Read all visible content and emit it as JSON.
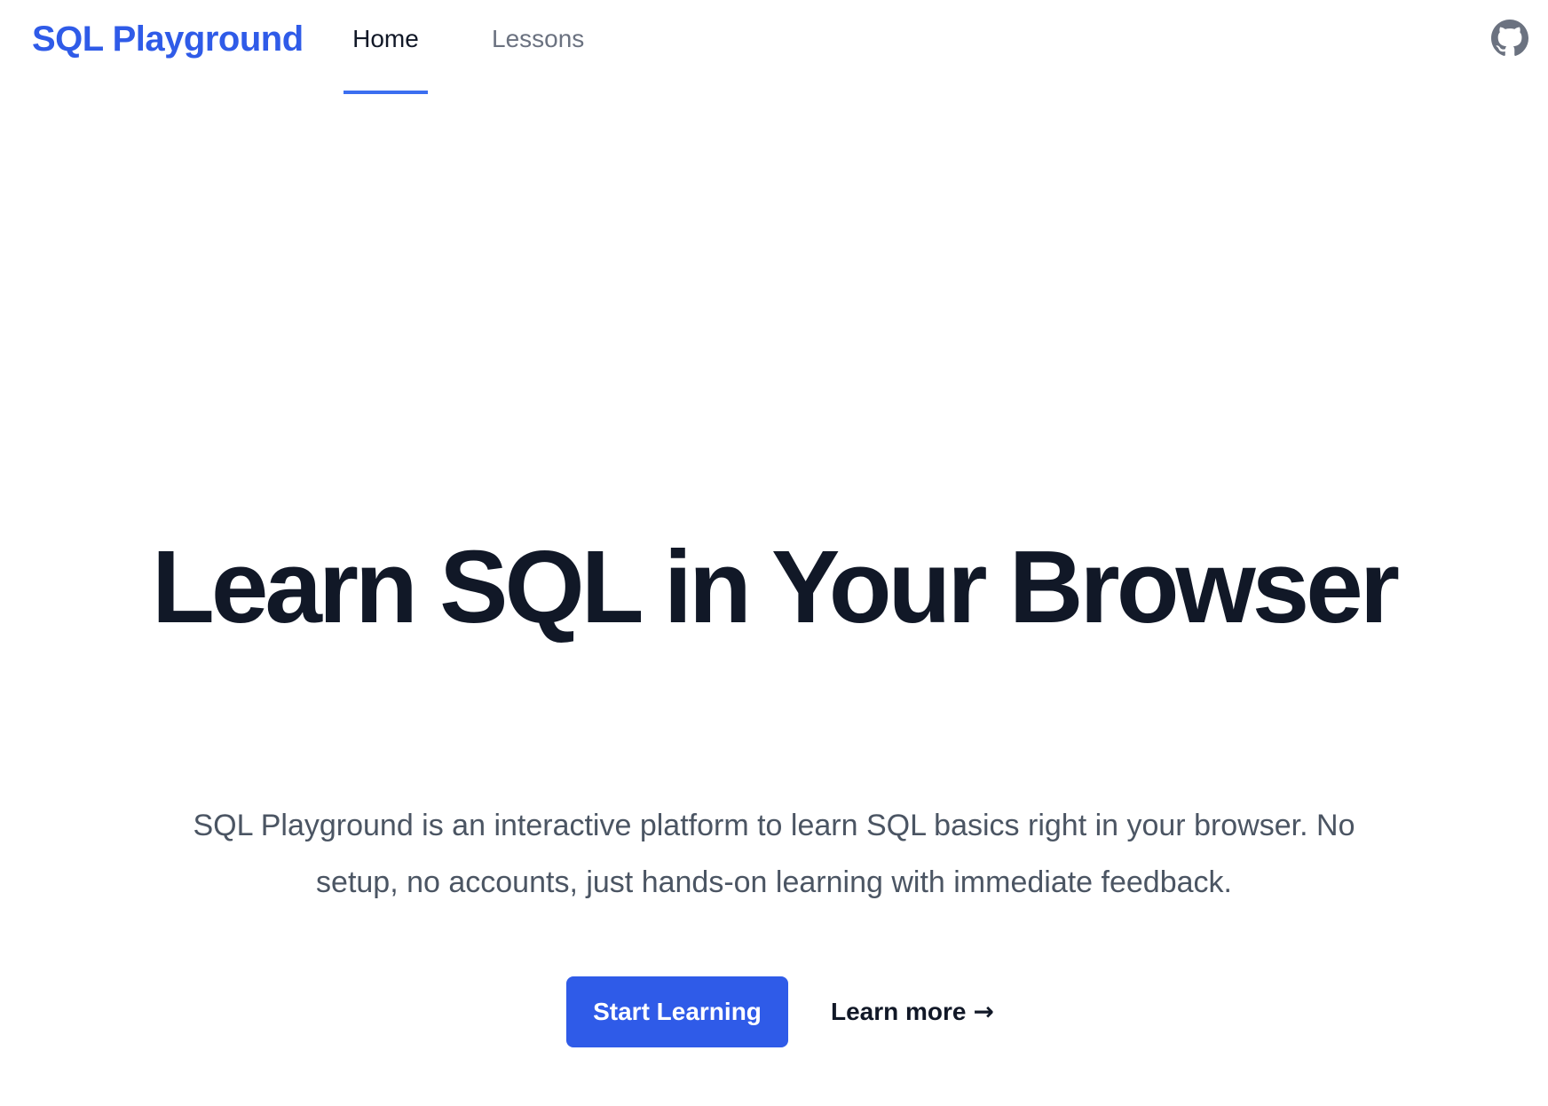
{
  "brand": {
    "name": "SQL Playground",
    "color": "#2f5be8"
  },
  "nav": {
    "items": [
      {
        "label": "Home",
        "active": true
      },
      {
        "label": "Lessons",
        "active": false
      }
    ],
    "active_indicator_color": "#3b6ef0"
  },
  "header": {
    "github_icon": "github-icon"
  },
  "hero": {
    "title": "Learn SQL in Your Browser",
    "subtitle": "SQL Playground is an interactive platform to learn SQL basics right in your browser. No setup, no accounts, just hands-on learning with immediate feedback.",
    "primary_cta": "Start Learning",
    "secondary_cta": "Learn more",
    "secondary_cta_icon": "arrow-right-icon",
    "secondary_cta_arrow": "→"
  }
}
